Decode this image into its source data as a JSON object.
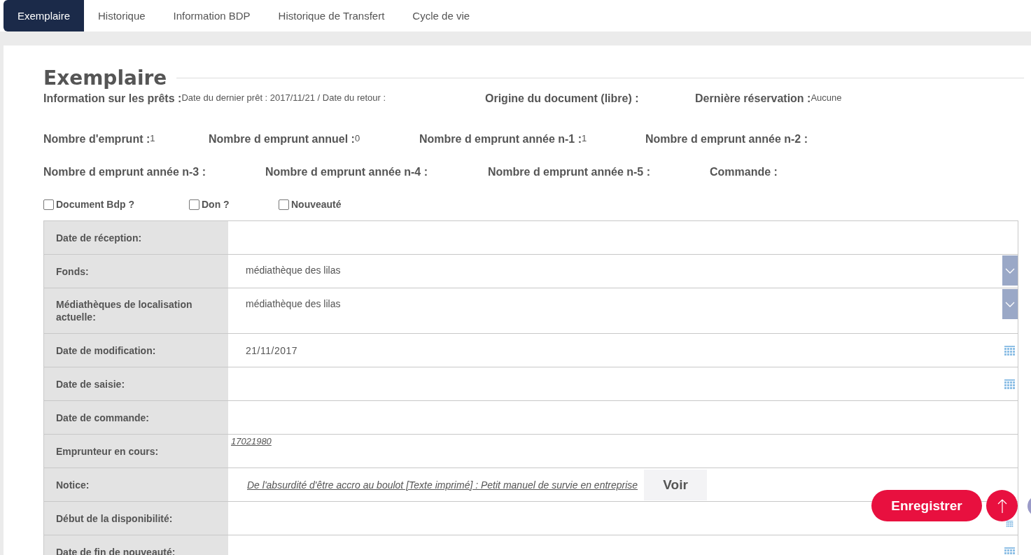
{
  "tabs": [
    {
      "label": "Exemplaire",
      "selected": true
    },
    {
      "label": "Historique",
      "selected": false
    },
    {
      "label": "Information BDP",
      "selected": false
    },
    {
      "label": "Historique de Transfert",
      "selected": false
    },
    {
      "label": "Cycle de vie",
      "selected": false
    }
  ],
  "section_title": "Exemplaire",
  "info_rows": [
    [
      {
        "label": "Information sur les prêts :",
        "value": "Date du dernier prêt : 2017/11/21 / Date du retour :"
      },
      {
        "label": "Origine du document (libre) :"
      },
      {
        "label": "Dernière réservation :",
        "value": "Aucune"
      }
    ],
    [
      {
        "label": "Nombre d'emprunt :",
        "value": "1"
      },
      {
        "label": "Nombre d emprunt annuel :",
        "value": "0"
      },
      {
        "label": "Nombre d emprunt année n-1 :",
        "value": "1"
      },
      {
        "label": "Nombre d emprunt année n-2 :"
      }
    ],
    [
      {
        "label": "Nombre d emprunt année n-3 :"
      },
      {
        "label": "Nombre d emprunt année n-4 :"
      },
      {
        "label": "Nombre d emprunt année n-5 :"
      },
      {
        "label": "Commande :"
      }
    ]
  ],
  "checkboxes": [
    {
      "label": "Document Bdp ?",
      "checked": false
    },
    {
      "label": "Don ?",
      "checked": false
    },
    {
      "label": "Nouveauté",
      "checked": false
    }
  ],
  "form_rows": [
    {
      "kind": "text",
      "label": "Date de réception:"
    },
    {
      "kind": "select",
      "label": "Fonds:",
      "value": "médiathèque des lilas"
    },
    {
      "kind": "select",
      "label": "Médiathèques de localisation actuelle:",
      "value": "médiathèque des lilas"
    },
    {
      "kind": "date",
      "label": "Date de modification:",
      "value": "21/11/2017"
    },
    {
      "kind": "date",
      "label": "Date de saisie:"
    },
    {
      "kind": "text",
      "label": "Date de commande:"
    },
    {
      "kind": "link",
      "label": "Emprunteur en cours:",
      "value": "17021980"
    },
    {
      "kind": "notice",
      "label": "Notice:",
      "value": "De l'absurdité d'être accro au boulot [Texte imprimé] : Petit manuel de survie en entreprise",
      "button": "Voir"
    },
    {
      "kind": "date",
      "label": "Début de la disponibilité:"
    },
    {
      "kind": "date",
      "label": "Date de fin de nouveauté:"
    }
  ],
  "save_button": "Enregistrer"
}
